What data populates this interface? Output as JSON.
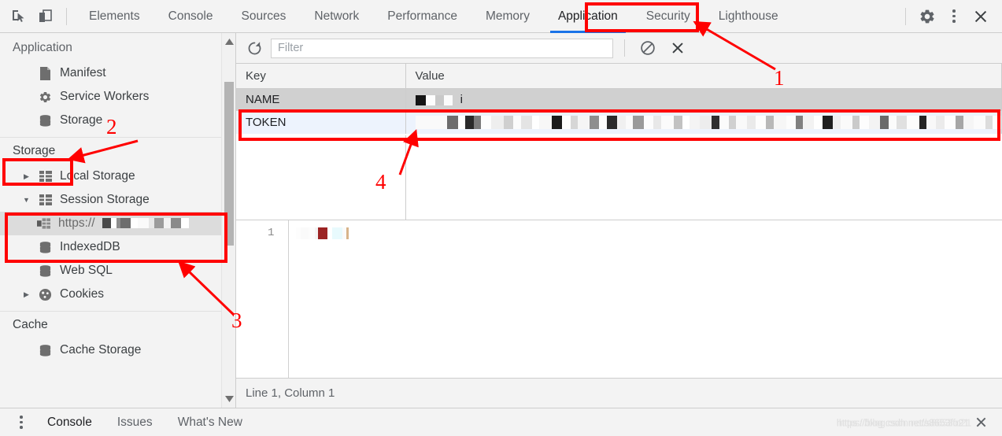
{
  "toolbar": {
    "icons": [
      {
        "name": "inspect-element-icon",
        "label": "Inspect element"
      },
      {
        "name": "device-toolbar-icon",
        "label": "Toggle device toolbar"
      }
    ],
    "tabs": [
      {
        "label": "Elements",
        "active": false
      },
      {
        "label": "Console",
        "active": false
      },
      {
        "label": "Sources",
        "active": false
      },
      {
        "label": "Network",
        "active": false
      },
      {
        "label": "Performance",
        "active": false
      },
      {
        "label": "Memory",
        "active": false
      },
      {
        "label": "Application",
        "active": true
      },
      {
        "label": "Security",
        "active": false
      },
      {
        "label": "Lighthouse",
        "active": false
      }
    ],
    "right_icons": [
      {
        "name": "gear-icon",
        "label": "Settings"
      },
      {
        "name": "kebab-menu-icon",
        "label": "Customize and control DevTools"
      },
      {
        "name": "close-icon",
        "label": "Close DevTools"
      }
    ]
  },
  "sidebar": {
    "application_title": "Application",
    "application_items": [
      {
        "label": "Manifest",
        "icon": "manifest-file-icon"
      },
      {
        "label": "Service Workers",
        "icon": "gear-icon"
      },
      {
        "label": "Storage",
        "icon": "database-icon"
      }
    ],
    "storage_title": "Storage",
    "storage_items": [
      {
        "label": "Local Storage",
        "icon": "grid-table-icon",
        "arrow": "▶",
        "expanded": false,
        "indent": 1,
        "selected": false
      },
      {
        "label": "Session Storage",
        "icon": "grid-table-icon",
        "arrow": "▼",
        "expanded": true,
        "indent": 1,
        "selected": false
      },
      {
        "label": "https://",
        "icon": "origin-frame-icon",
        "arrow": "",
        "expanded": false,
        "indent": 2,
        "selected": true,
        "redacted": true
      },
      {
        "label": "IndexedDB",
        "icon": "database-icon",
        "arrow": "",
        "expanded": false,
        "indent": 1,
        "selected": false
      },
      {
        "label": "Web SQL",
        "icon": "database-icon",
        "arrow": "",
        "expanded": false,
        "indent": 1,
        "selected": false
      },
      {
        "label": "Cookies",
        "icon": "cookie-icon",
        "arrow": "▶",
        "expanded": false,
        "indent": 1,
        "selected": false
      }
    ],
    "cache_title": "Cache",
    "cache_items": [
      {
        "label": "Cache Storage",
        "icon": "database-icon"
      }
    ],
    "scrollbar": {
      "up_arrow": "▲",
      "down_arrow": "▼"
    }
  },
  "main": {
    "toolbar": {
      "refresh_icon": "refresh-icon",
      "filter_placeholder": "Filter",
      "filter_value": "",
      "clear_icon": "no-entry-clear-icon",
      "delete_icon": "close-x-icon"
    },
    "table": {
      "columns": [
        "Key",
        "Value"
      ],
      "rows": [
        {
          "key": "NAME",
          "value": "",
          "value_redacted": true,
          "state": "selected-inactive"
        },
        {
          "key": "TOKEN",
          "value": "Bearer",
          "value_redacted": true,
          "state": "selected"
        }
      ]
    },
    "preview": {
      "line_number": "1",
      "content_redacted": true
    },
    "status": "Line 1, Column 1"
  },
  "drawer": {
    "menu_icon": "kebab-menu-icon",
    "tabs": [
      {
        "label": "Console",
        "active": true
      },
      {
        "label": "Issues",
        "active": false
      },
      {
        "label": "What's New",
        "active": false
      }
    ],
    "close_icon": "close-x-icon",
    "watermark_a": "https://blog.csdn.net/s8653fo21",
    "watermark_b": "https://blog.csdn.net/s8653fo21"
  },
  "annotations": [
    {
      "id": "anno-1",
      "number": "1",
      "target": "application-tab"
    },
    {
      "id": "anno-2",
      "number": "2",
      "target": "storage-section-header"
    },
    {
      "id": "anno-3",
      "number": "3",
      "target": "session-storage-group"
    },
    {
      "id": "anno-4",
      "number": "4",
      "target": "token-row"
    }
  ],
  "colors": {
    "accent": "#1a73e8",
    "annotation": "#ff0000",
    "selected_row": "#edf3fd",
    "inactive_row": "#d0d0d0",
    "toolbar_bg": "#f3f3f3"
  }
}
